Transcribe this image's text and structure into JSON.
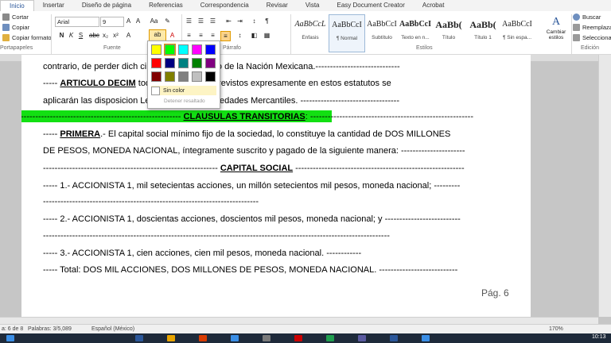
{
  "tabs": [
    "Inicio",
    "Insertar",
    "Diseño de página",
    "Referencias",
    "Correspondencia",
    "Revisar",
    "Vista",
    "Easy Document Creator",
    "Acrobat"
  ],
  "clipboard": {
    "cut": "Cortar",
    "copy": "Copiar",
    "format": "Copiar formato",
    "label": "Portapapeles"
  },
  "font": {
    "name": "Arial",
    "size": "9",
    "label": "Fuente"
  },
  "paragraph": {
    "label": "Párrafo"
  },
  "styles": {
    "label": "Estilos",
    "items": [
      {
        "preview": "AaBbCcL",
        "name": "Énfasis"
      },
      {
        "preview": "AaBbCcI",
        "name": "¶ Normal"
      },
      {
        "preview": "AaBbCcI",
        "name": "Subtítulo"
      },
      {
        "preview": "AaBbCcI",
        "name": "Texto en n..."
      },
      {
        "preview": "AaBb(",
        "name": "Título"
      },
      {
        "preview": "AaBb(",
        "name": "Título 1"
      },
      {
        "preview": "AaBbCcI",
        "name": "¶ Sin espa..."
      }
    ],
    "change": "Cambiar estilos"
  },
  "editing": {
    "find": "Buscar",
    "replace": "Reemplazar",
    "select": "Seleccionar",
    "label": "Edición"
  },
  "highlight_popup": {
    "colors": [
      "#ffff00",
      "#00ff00",
      "#00ffff",
      "#ff00ff",
      "#0000ff",
      "#ff0000",
      "#000080",
      "#008080",
      "#008000",
      "#800080",
      "#800000",
      "#808000",
      "#808080",
      "#c0c0c0",
      "#000000"
    ],
    "no_color": "Sin color",
    "stop": "Detener resaltado"
  },
  "document": {
    "line1": "contrario, de perder dich         cipación en beneficio de la Nación Mexicana.-----------------------------",
    "line2_pre": "----- ",
    "line2_bold": "ARTICULO DECIM",
    "line2_post": "           todos los casos no previstos expresamente en estos estatutos se",
    "line3": "aplicarán las disposicion          Ley General de Sociedades Mercantiles. ----------------------------------",
    "line4_pre": "------------------------------------------------------- ",
    "line4_bold": "CLAUSULAS TRANSITORIAS",
    "line4_post": ": --------------------------------------------------------",
    "line5_pre": "----- ",
    "line5_bold": "PRIMERA",
    "line5_post": ".- El capital social mínimo fijo de la sociedad, lo constituye la cantidad de DOS MILLONES",
    "line6": "DE PESOS, MONEDA NACIONAL, íntegramente suscrito y pagado de la siguiente manera: ----------------------",
    "line7_pre": "------------------------------------------------------------ ",
    "line7_bold": "CAPITAL SOCIAL",
    "line7_post": " ----------------------------------------------------------",
    "line8": "----- 1.- ACCIONISTA 1, mil setecientas acciones, un millón setecientos mil pesos, moneda nacional; ---------",
    "line9": "--------------------------------------------------------------------------",
    "line10": "----- 2.- ACCIONISTA 1, doscientas acciones, doscientos mil pesos, moneda nacional; y --------------------------",
    "line11": "-----------------------------------------------------------------------------------------------------------------------",
    "line12": "----- 3.- ACCIONISTA 1, cien acciones, cien mil pesos, moneda nacional.  ------------",
    "line13": "----- Total: DOS MIL ACCIONES, DOS MILLONES DE PESOS, MONEDA NACIONAL. ---------------------------",
    "page_label": "Pág. 6"
  },
  "status": {
    "page": "a: 6 de 8",
    "words": "Palabras: 3/5,089",
    "lang": "Español (México)",
    "zoom": "170%"
  },
  "taskbar": {
    "time": "10:13"
  }
}
